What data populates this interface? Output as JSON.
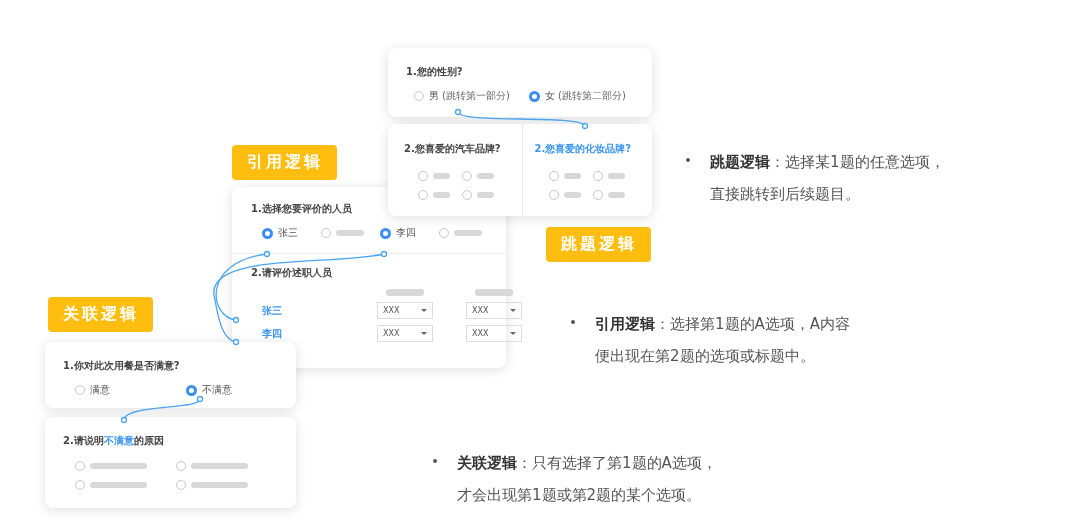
{
  "skip_logic": {
    "tag": "跳题逻辑",
    "question_1": {
      "title": "1.您的性别?",
      "options": [
        {
          "label": "男",
          "note": "(跳转第一部分)",
          "selected": false
        },
        {
          "label": "女",
          "note": "(跳转第二部分)",
          "selected": true
        }
      ]
    },
    "branches": [
      {
        "title": "2.您喜爱的汽车品牌?",
        "highlighted": false,
        "options": [
          {
            "kind": "blank",
            "selected": false
          },
          {
            "kind": "blank",
            "selected": false
          },
          {
            "kind": "blank",
            "selected": false
          },
          {
            "kind": "blank",
            "selected": false
          }
        ]
      },
      {
        "title": "2.您喜爱的化妆品牌?",
        "highlighted": true,
        "options": [
          {
            "kind": "blank",
            "selected": false
          },
          {
            "kind": "blank",
            "selected": false
          },
          {
            "kind": "blank",
            "selected": false
          },
          {
            "kind": "blank",
            "selected": false
          }
        ]
      }
    ]
  },
  "reference_logic": {
    "tag": "引用逻辑",
    "question_1": {
      "title": "1.选择您要评价的人员",
      "options": [
        {
          "kind": "text",
          "label": "张三",
          "selected": true
        },
        {
          "kind": "blank",
          "selected": false
        },
        {
          "kind": "text",
          "label": "李四",
          "selected": true
        },
        {
          "kind": "blank",
          "selected": false
        }
      ]
    },
    "question_2": {
      "title": "2.请评价述职人员",
      "rows": [
        {
          "label": "张三",
          "selects": [
            "XXX",
            "XXX"
          ]
        },
        {
          "label": "李四",
          "selects": [
            "XXX",
            "XXX"
          ]
        }
      ]
    }
  },
  "association_logic": {
    "tag": "关联逻辑",
    "question_1": {
      "title": "1.你对此次用餐是否满意?",
      "options": [
        {
          "label": "满意",
          "selected": false
        },
        {
          "label": "不满意",
          "selected": true
        }
      ]
    },
    "question_2": {
      "title_parts": [
        {
          "text": "2.请说明",
          "highlighted": false
        },
        {
          "text": "不满意",
          "highlighted": true
        },
        {
          "text": "的原因",
          "highlighted": false
        }
      ],
      "options": [
        {
          "kind": "blank",
          "selected": false
        },
        {
          "kind": "blank",
          "selected": false
        },
        {
          "kind": "blank",
          "selected": false
        },
        {
          "kind": "blank",
          "selected": false
        }
      ]
    }
  },
  "descriptions": [
    {
      "lines": [
        "**跳题逻辑**：选择某1题的任意选项，",
        "直接跳转到后续题目。"
      ]
    },
    {
      "lines": [
        "**引用逻辑**：选择第1题的A选项，A内容",
        "便出现在第2题的选项或标题中。"
      ]
    },
    {
      "lines": [
        "**关联逻辑**：只有选择了第1题的A选项，",
        "才会出现第1题或第2题的某个选项。"
      ]
    }
  ]
}
